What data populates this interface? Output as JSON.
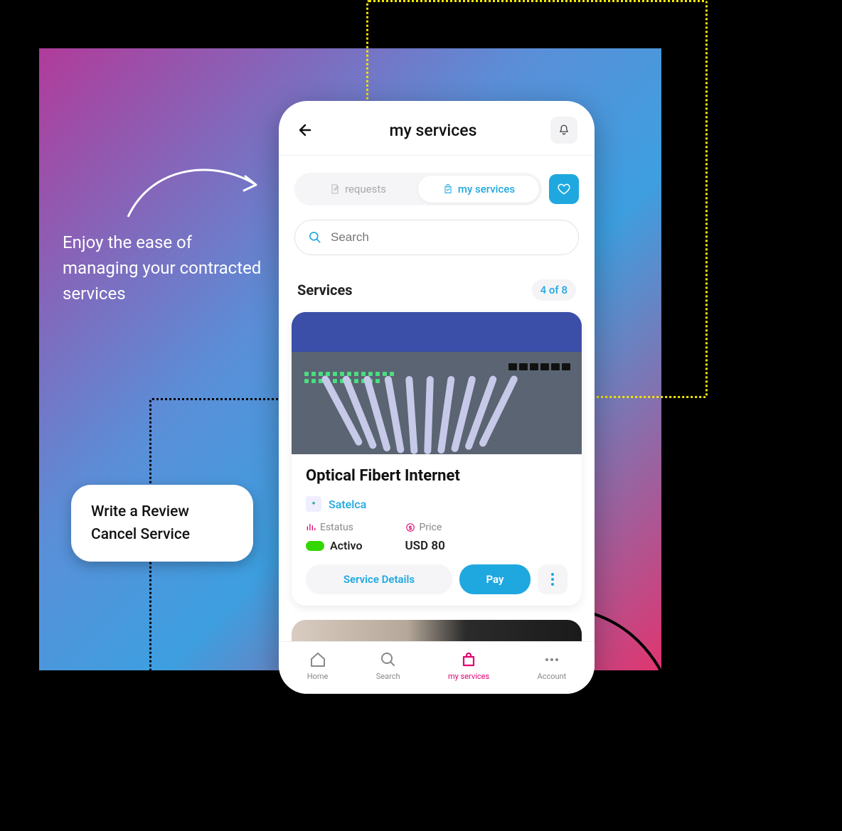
{
  "marketing": {
    "headline": "Enjoy the ease of managing your contracted services"
  },
  "popup_options": {
    "write_review": "Write a Review",
    "cancel_service": "Cancel Service"
  },
  "header": {
    "title": "my services"
  },
  "tabs": {
    "requests": "requests",
    "my_services": "my services"
  },
  "search": {
    "placeholder": "Search"
  },
  "section": {
    "title": "Services",
    "count_label": "4 of 8"
  },
  "service_card": {
    "title": "Optical Fibert Internet",
    "provider": "Satelca",
    "status_label": "Estatus",
    "status_value": "Activo",
    "price_label": "Price",
    "price_value": "USD 80",
    "details_btn": "Service Details",
    "pay_btn": "Pay"
  },
  "bottom_nav": {
    "home": "Home",
    "search": "Search",
    "my_services": "my services",
    "account": "Account"
  },
  "colors": {
    "accent": "#1fa8e0",
    "brand_pink": "#e00072",
    "status_green": "#34d600"
  }
}
